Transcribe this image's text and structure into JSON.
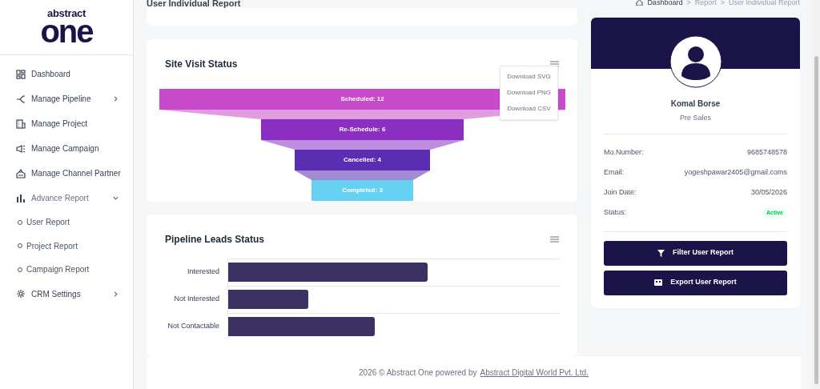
{
  "logo": {
    "top": "abstract",
    "bottom": "one"
  },
  "sidebar": {
    "items": [
      {
        "label": "Dashboard"
      },
      {
        "label": "Manage Pipeline",
        "expanded": false
      },
      {
        "label": "Manage Project"
      },
      {
        "label": "Manage Campaign"
      },
      {
        "label": "Manage Channel Partner"
      },
      {
        "label": "Advance Report",
        "expanded": true,
        "children": [
          {
            "label": "User Report"
          },
          {
            "label": "Project Report"
          },
          {
            "label": "Campaign Report"
          }
        ]
      },
      {
        "label": "CRM Settings",
        "expanded": false
      }
    ]
  },
  "page_title": "User Individual Report",
  "breadcrumb": [
    {
      "kind": "link",
      "text": "Dashboard"
    },
    {
      "kind": "separator",
      "text": ">"
    },
    {
      "kind": "link",
      "text": "Report"
    },
    {
      "kind": "separator",
      "text": ">"
    },
    {
      "kind": "link",
      "text": "User Individual Report"
    }
  ],
  "site_visit": {
    "title": "Site Visit Status",
    "menu": [
      "Download SVG",
      "Download PNG",
      "Download CSV"
    ],
    "stages": [
      {
        "name": "Scheduled:",
        "count": "12",
        "color": "#c84bcb"
      },
      {
        "name": "Re-Schedule:",
        "count": "6",
        "color": "#8a2fc2"
      },
      {
        "name": "Cancelled:",
        "count": "4",
        "color": "#5a2db3"
      },
      {
        "name": "Completed:",
        "count": "3",
        "color": "#66d1f0"
      }
    ]
  },
  "pipeline": {
    "title": "Pipeline Leads Status",
    "bars": [
      {
        "label": "Interested",
        "level": 0.6
      },
      {
        "label": "Not Interested",
        "level": 0.24
      },
      {
        "label": "Not Contactable",
        "level": 0.44
      }
    ]
  },
  "profile": {
    "name": "Komal Borse",
    "role": "Pre Sales",
    "fields": [
      {
        "label": "Mo.Number:",
        "value": "9685748578"
      },
      {
        "label": "Email:",
        "value": "yogeshpawar2405@gmail.coms"
      },
      {
        "label": "Join Date:",
        "value": "30/05/2026"
      }
    ],
    "status": {
      "label": "Status:",
      "value": "Active"
    },
    "buttons": [
      {
        "label": "Filter User Report"
      },
      {
        "label": "Export User Report"
      }
    ]
  },
  "footer": {
    "text": "2026 © Abstract One powered by",
    "link": "Abstract Digital World Pvt. Ltd."
  }
}
